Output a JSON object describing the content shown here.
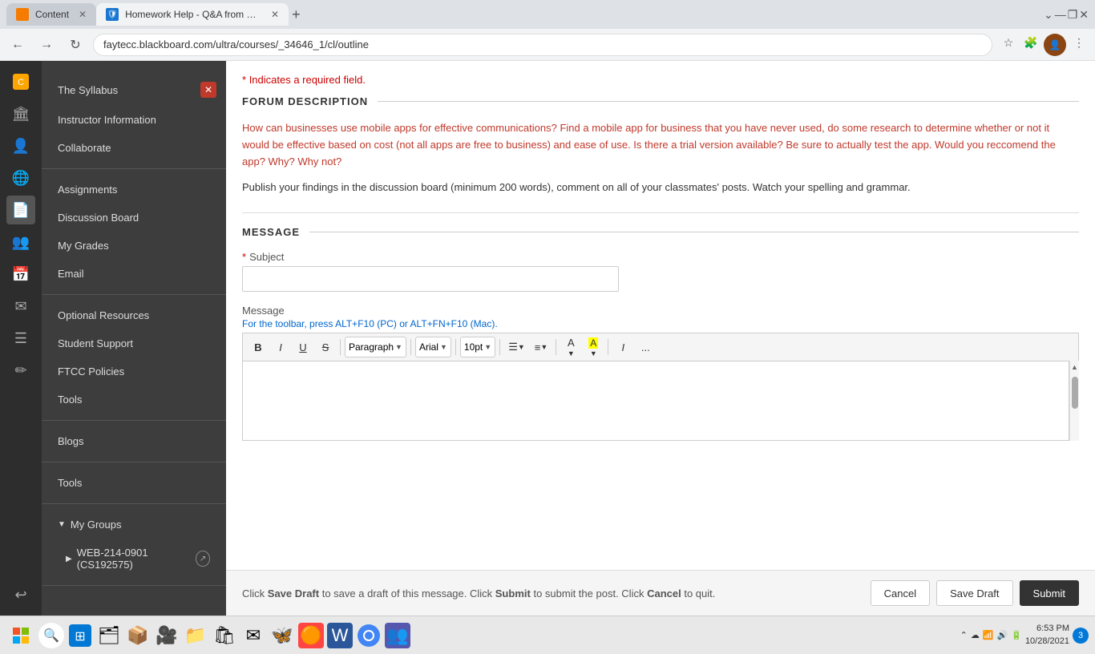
{
  "browser": {
    "tabs": [
      {
        "id": "tab1",
        "label": "Content",
        "favicon": "orange",
        "active": false
      },
      {
        "id": "tab2",
        "label": "Homework Help - Q&A from On...",
        "favicon": "blue",
        "active": true
      }
    ],
    "address": "faytecc.blackboard.com/ultra/courses/_34646_1/cl/outline",
    "new_tab_label": "+"
  },
  "sidebar": {
    "nav_sections": [
      {
        "items": [
          {
            "label": "The Syllabus",
            "close": true
          },
          {
            "label": "Instructor Information"
          },
          {
            "label": "Collaborate"
          }
        ]
      },
      {
        "items": [
          {
            "label": "Assignments"
          },
          {
            "label": "Discussion Board"
          },
          {
            "label": "My Grades"
          },
          {
            "label": "Email"
          }
        ]
      },
      {
        "items": [
          {
            "label": "Optional Resources"
          },
          {
            "label": "Student Support"
          },
          {
            "label": "FTCC Policies"
          },
          {
            "label": "Tools"
          }
        ]
      },
      {
        "items": [
          {
            "label": "Blogs"
          }
        ]
      },
      {
        "items": [
          {
            "label": "Tools"
          }
        ]
      }
    ],
    "my_groups": {
      "header": "My Groups",
      "sub_items": [
        {
          "label": "WEB-214-0901 (CS192575)",
          "has_arrow": true
        }
      ]
    }
  },
  "content": {
    "required_note": "* Indicates a required field.",
    "forum_description_title": "FORUM DESCRIPTION",
    "forum_text_1": "How can businesses use mobile apps for effective communications? Find a mobile app for business that you have never used, do some research to determine whether or not it would be effective based on cost (not all apps are free to business) and ease of use. Is there a trial version available? Be sure to actually test the app.  Would you reccomend the app? Why? Why not?",
    "forum_text_2": "Publish your findings in the discussion board (minimum 200 words), comment on all of your classmates' posts. Watch your spelling and grammar.",
    "message_title": "MESSAGE",
    "subject_label": "Subject",
    "message_label": "Message",
    "toolbar_hint": "For the toolbar, press ALT+F10 (PC) or ALT+FN+F10 (Mac).",
    "toolbar": {
      "bold": "B",
      "italic": "I",
      "underline": "U",
      "strikethrough": "S",
      "paragraph_label": "Paragraph",
      "font_label": "Arial",
      "size_label": "10pt",
      "more": "..."
    }
  },
  "footer": {
    "text_before_save": "Click ",
    "save_draft_bold": "Save Draft",
    "text_after_save": " to save a draft of this message. Click ",
    "submit_bold": "Submit",
    "text_after_submit": " to submit the post. Click ",
    "cancel_bold": "Cancel",
    "text_end": " to quit.",
    "cancel_btn": "Cancel",
    "save_draft_btn": "Save Draft",
    "submit_btn": "Submit"
  },
  "taskbar": {
    "time": "6:53 PM",
    "date": "10/28/2021",
    "badge_count": "3"
  }
}
